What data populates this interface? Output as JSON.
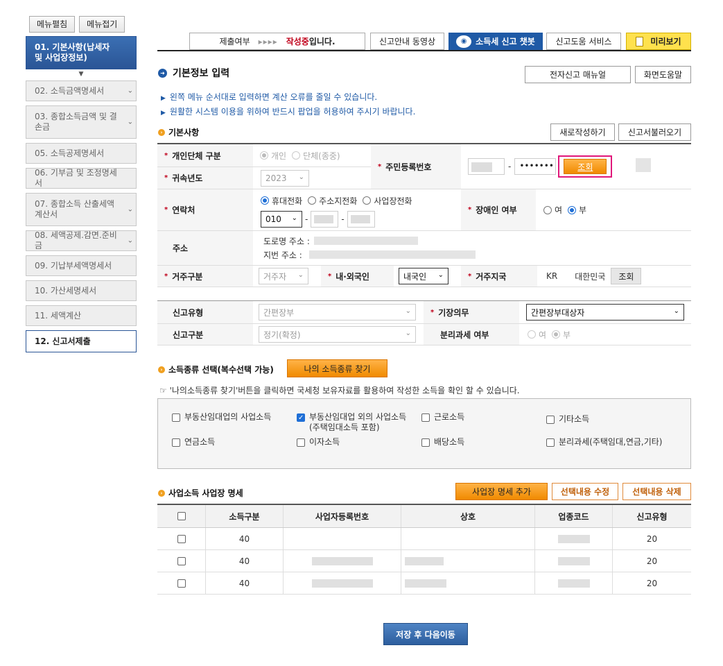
{
  "sidebar": {
    "expand_label": "메뉴펼침",
    "collapse_label": "메뉴접기",
    "items": [
      {
        "label": "01. 기본사항(납세자 및 사업장정보)"
      },
      {
        "label": "02. 소득금액명세서"
      },
      {
        "label": "03. 종합소득금액 및 결손금"
      },
      {
        "label": "05. 소득공제명세서"
      },
      {
        "label": "06. 기부금 및 조정명세서"
      },
      {
        "label": "07. 종합소득 산출세액계산서"
      },
      {
        "label": "08. 세액공제.감면.준비금"
      },
      {
        "label": "09. 기납부세액명세서"
      },
      {
        "label": "10. 가산세명세서"
      },
      {
        "label": "11. 세액계산"
      },
      {
        "label": "12. 신고서제출"
      }
    ]
  },
  "topbar": {
    "status_prefix": "제출여부",
    "status_arrows": "▸▸▸▸",
    "status_red": "작성중",
    "status_suffix": "입니다.",
    "video_label": "신고안내 동영상",
    "chat_label": "소득세 신고 챗봇",
    "help_label": "신고도움 서비스",
    "preview_label": "미리보기"
  },
  "page": {
    "title": "기본정보 입력",
    "manual_btn": "전자신고 매뉴얼",
    "screen_help_btn": "화면도움말",
    "notice1": "왼쪽 메뉴 순서대로 입력하면 계산 오류를 줄일 수 있습니다.",
    "notice2": "원활한 시스템 이용을 위하여 반드시 팝업을 허용하여 주시기 바랍니다."
  },
  "basic": {
    "title": "기본사항",
    "new_btn": "새로작성하기",
    "load_btn": "신고서불러오기",
    "type_label": "개인단체 구분",
    "type_opt1": "개인",
    "type_opt2": "단체(종중)",
    "year_label": "귀속년도",
    "year_value": "2023",
    "rrn_label": "주민등록번호",
    "rrn_mask": "•••••••",
    "rrn_dash": "-",
    "lookup_btn": "조회",
    "contact_label": "연락처",
    "phone_opt1": "휴대전화",
    "phone_opt2": "주소지전화",
    "phone_opt3": "사업장전화",
    "phone_prefix": "010",
    "disabled_label": "장애인 여부",
    "yes": "여",
    "no": "부",
    "address_label": "주소",
    "road_addr_label": "도로명 주소 :",
    "lot_addr_label": "지번 주소 :",
    "residence_label": "거주구분",
    "residence_value": "거주자",
    "nationality_label": "내·외국인",
    "nationality_value": "내국인",
    "country_label": "거주지국",
    "country_code": "KR",
    "country_name": "대한민국",
    "country_btn": "조회"
  },
  "report": {
    "type_label": "신고유형",
    "type_value": "간편장부",
    "bookkeeping_label": "기장의무",
    "bookkeeping_value": "간편장부대상자",
    "category_label": "신고구분",
    "category_value": "정기(확정)",
    "separate_label": "분리과세 여부",
    "yes": "여",
    "no": "부"
  },
  "income": {
    "title": "소득종류 선택(복수선택 가능)",
    "find_btn": "나의 소득종류 찾기",
    "hint": "☞ '나의소득종류 찾기'버튼을 클릭하면 국세청 보유자료를 활용하여 작성한 소득을 확인 할 수 있습니다.",
    "items": [
      {
        "label": "부동산임대업의 사업소득",
        "sub": ""
      },
      {
        "label": "부동산임대업 외의 사업소득",
        "sub": "(주택임대소득 포함)"
      },
      {
        "label": "근로소득",
        "sub": ""
      },
      {
        "label": "기타소득",
        "sub": ""
      },
      {
        "label": "연금소득",
        "sub": ""
      },
      {
        "label": "이자소득",
        "sub": ""
      },
      {
        "label": "배당소득",
        "sub": ""
      },
      {
        "label": "분리과세(주택임대,연금,기타)",
        "sub": ""
      }
    ]
  },
  "biz": {
    "title": "사업소득 사업장 명세",
    "add_btn": "사업장 명세 추가",
    "edit_btn": "선택내용 수정",
    "delete_btn": "선택내용 삭제",
    "headers": [
      "소득구분",
      "사업자등록번호",
      "상호",
      "업종코드",
      "신고유형"
    ],
    "rows": [
      {
        "income_type": "40",
        "report_type": "20"
      },
      {
        "income_type": "40",
        "report_type": "20"
      },
      {
        "income_type": "40",
        "report_type": "20"
      }
    ]
  },
  "footer": {
    "save_btn": "저장 후 다음이동"
  }
}
